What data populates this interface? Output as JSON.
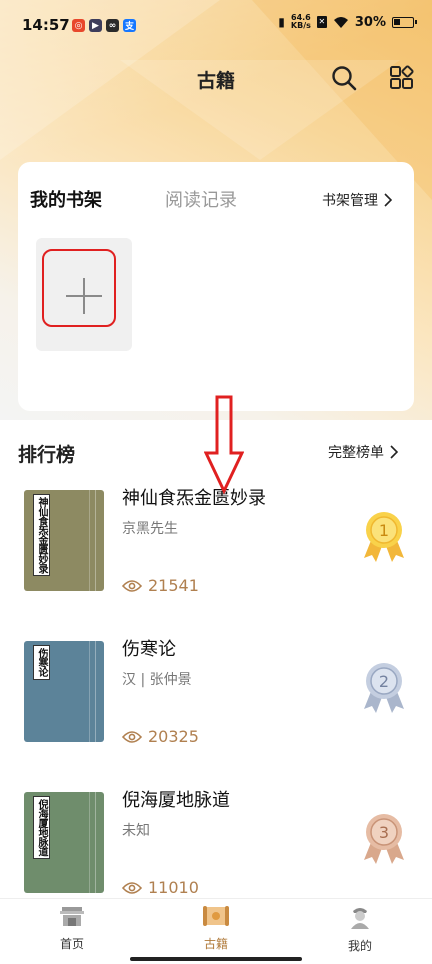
{
  "status_bar": {
    "time": "14:57",
    "net_speed_value": "64.6",
    "net_speed_unit": "KB/s",
    "battery": "30%"
  },
  "header": {
    "title": "古籍",
    "search_icon": "search-icon",
    "apps_icon": "grid-apps-icon"
  },
  "shelf": {
    "tab_active": "我的书架",
    "tab_inactive": "阅读记录",
    "manage_label": "书架管理"
  },
  "ranking": {
    "title": "排行榜",
    "more_label": "完整榜单",
    "books": [
      {
        "title": "神仙食炁金匮妙录",
        "author": "京黑先生",
        "views": "21541",
        "cover_label": "神仙食炁金匮妙录",
        "cover_color": "#8d8a62",
        "medal_rank": "1",
        "medal_color": "#f4c430"
      },
      {
        "title": "伤寒论",
        "author": "汉 | 张仲景",
        "views": "20325",
        "cover_label": "伤寒论",
        "cover_color": "#5c8399",
        "medal_rank": "2",
        "medal_color": "#b8c4d8"
      },
      {
        "title": "倪海厦地脉道",
        "author": "未知",
        "views": "11010",
        "cover_label": "倪海厦地脉道",
        "cover_color": "#6f8d6c",
        "medal_rank": "3",
        "medal_color": "#e0b8a0"
      }
    ]
  },
  "bottom_nav": {
    "items": [
      {
        "label": "首页"
      },
      {
        "label": "古籍"
      },
      {
        "label": "我的"
      }
    ]
  },
  "colors": {
    "accent": "#b07a3a",
    "highlight": "#e02020"
  }
}
